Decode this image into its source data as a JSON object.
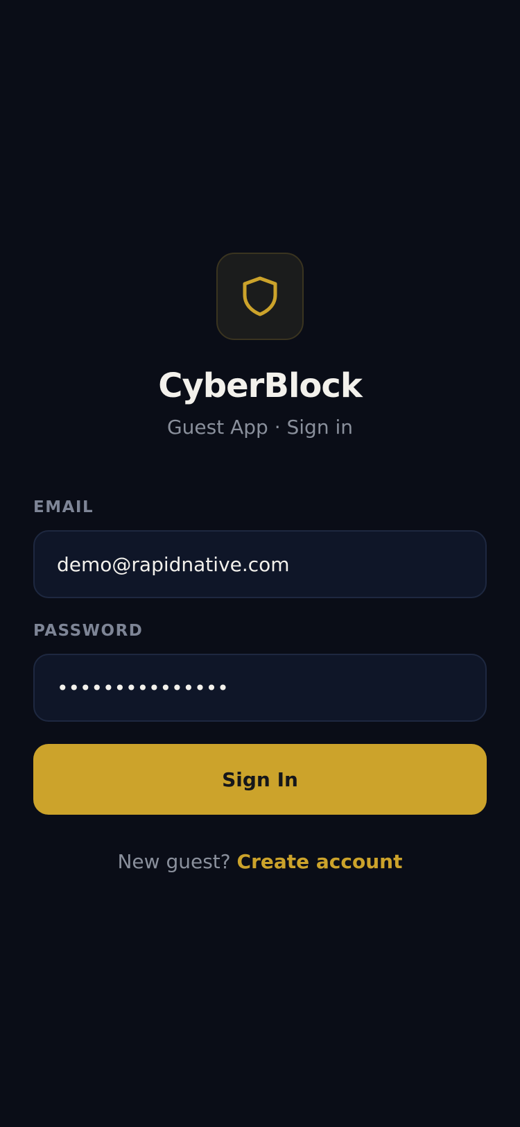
{
  "app": {
    "title": "CyberBlock",
    "subtitle": "Guest App · Sign in",
    "logo_icon": "shield-icon"
  },
  "form": {
    "email_label": "EMAIL",
    "email_value": "demo@rapidnative.com",
    "password_label": "PASSWORD",
    "password_value": "•••••••••••••••",
    "submit_label": "Sign In"
  },
  "footer": {
    "prompt": "New guest?",
    "link": "Create account"
  },
  "colors": {
    "background": "#0a0d17",
    "accent": "#cca32b",
    "input_bg": "#0f1628",
    "muted_text": "#8a909c"
  }
}
